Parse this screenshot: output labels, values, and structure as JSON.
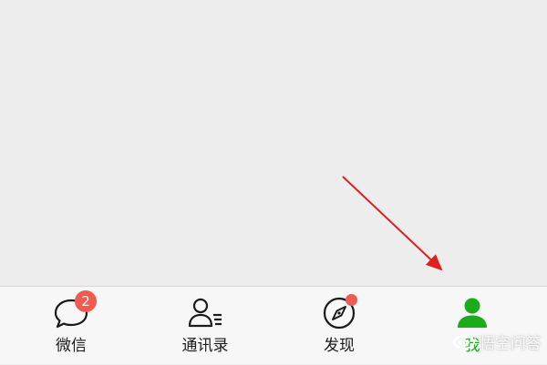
{
  "tabbar": {
    "tabs": [
      {
        "label": "微信",
        "badge": "2"
      },
      {
        "label": "通讯录"
      },
      {
        "label": "发现"
      },
      {
        "label": "我"
      }
    ]
  },
  "colors": {
    "active": "#1aad19",
    "badge": "#f05a50",
    "arrow": "#e02020"
  },
  "watermark": {
    "text": "悟空问答"
  }
}
